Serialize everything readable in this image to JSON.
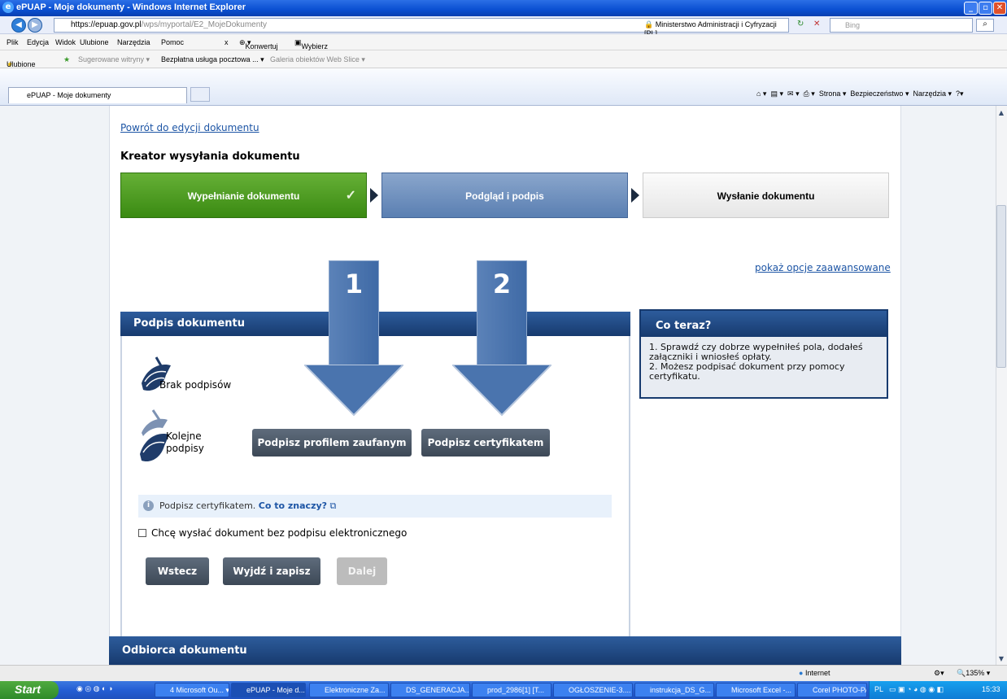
{
  "window": {
    "title": "ePUAP - Moje dokumenty - Windows Internet Explorer"
  },
  "address": {
    "url_main": "https://epuap.gov.pl",
    "url_rest": "/wps/myportal/E2_MojeDokumenty",
    "cert": "Ministerstwo Administracji i Cyfryzacji [PL]",
    "search_placeholder": "Bing"
  },
  "menu": [
    "Plik",
    "Edycja",
    "Widok",
    "Ulubione",
    "Narzędzia",
    "Pomoc"
  ],
  "menu_extra": {
    "konwertuj": "Konwertuj",
    "wybierz": "Wybierz"
  },
  "favorites": {
    "label": "Ulubione",
    "items": [
      "Sugerowane witryny ▾",
      "Bezpłatna usługa pocztowa ... ▾",
      "Galeria obiektów Web Slice ▾"
    ]
  },
  "tab": {
    "title": "ePUAP - Moje dokumenty"
  },
  "commandbar": [
    "Strona ▾",
    "Bezpieczeństwo ▾",
    "Narzędzia ▾"
  ],
  "page": {
    "back_link": "Powrót do edycji dokumentu",
    "kreator_title": "Kreator wysyłania dokumentu",
    "steps": [
      "Wypełnianie dokumentu",
      "Podgląd i podpis",
      "Wysłanie dokumentu"
    ],
    "advanced_link": "pokaż opcje zaawansowane",
    "sign_panel": {
      "title": "Podpis dokumentu",
      "no_sig": "Brak podpisów",
      "next_sig_1": "Kolejne",
      "next_sig_2": "podpisy",
      "btn_profile": "Podpisz profilem zaufanym",
      "btn_cert": "Podpisz certyfikatem",
      "info_text": "Podpisz certyfikatem.",
      "info_link": "Co to znaczy?",
      "checkbox_label": "Chcę wysłać dokument bez podpisu elektronicznego",
      "btn_back": "Wstecz",
      "btn_exit": "Wyjdź i zapisz",
      "btn_next": "Dalej"
    },
    "co_teraz": {
      "title": "Co teraz?",
      "line1": "1. Sprawdź czy dobrze wypełniłeś pola, dodałeś załączniki i wniosłeś opłaty.",
      "line2": "2. Możesz podpisać dokument przy pomocy certyfikatu."
    },
    "recipient_title": "Odbiorca dokumentu",
    "arrow_labels": [
      "1",
      "2"
    ]
  },
  "status": {
    "zone": "Internet",
    "zoom": "135%"
  },
  "taskbar": {
    "start": "Start",
    "items": [
      "4 Microsoft Ou... ▾",
      "ePUAP - Moje d...",
      "Elektroniczne Za...",
      "DS_GENERACJA...",
      "prod_2986[1] [T...",
      "OGŁOSZENIE-3....",
      "instrukcja_DS_G...",
      "Microsoft Excel -...",
      "Corel PHOTO-PA..."
    ],
    "lang": "PL",
    "time": "15:33"
  }
}
